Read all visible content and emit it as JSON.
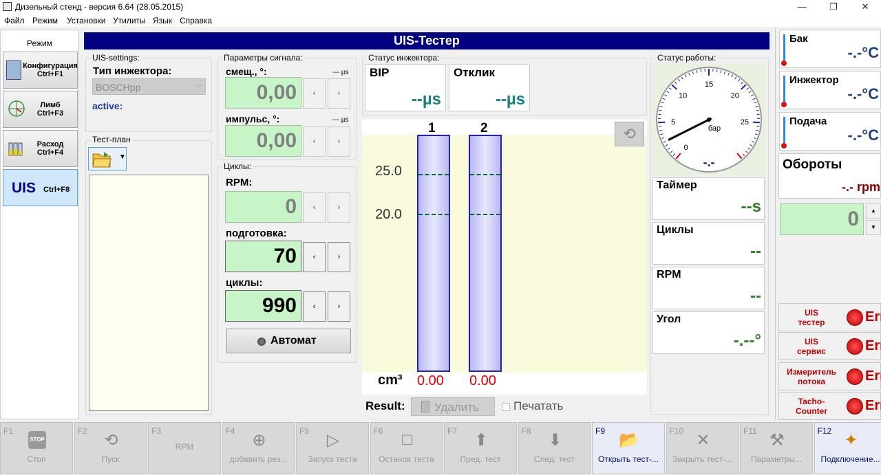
{
  "window": {
    "title": "Дизельный стенд - версия 6.64 (28.05.2015)",
    "min": "—",
    "max": "❐",
    "close": "✕"
  },
  "menu": [
    "Файл",
    "Режим",
    "Установки",
    "Утилиты",
    "Язык",
    "Справка"
  ],
  "mode": {
    "title": "Режим",
    "buttons": [
      {
        "label": "Конфигурация\nCtrl+F1"
      },
      {
        "label": "Лимб\nCtrl+F3"
      },
      {
        "label": "Расход\nCtrl+F4"
      },
      {
        "big": "UIS",
        "shortcut": "Ctrl+F8"
      }
    ]
  },
  "header": "UIS-Тестер",
  "settings": {
    "title": "UIS-settings:",
    "injector_type_label": "Тип инжектора:",
    "injector_type": "BOSCHpp",
    "status": "active:"
  },
  "testplan": {
    "title": "Тест-план"
  },
  "signal": {
    "title": "Параметры сигнала:",
    "offset_label": "смещ., °:",
    "offset_unit": "--- µs",
    "offset": "0,00",
    "pulse_label": "импульс, °:",
    "pulse_unit": "--- µs",
    "pulse": "0,00"
  },
  "cycles": {
    "title": "Циклы:",
    "rpm_label": "RPM:",
    "rpm": "0",
    "prep_label": "подготовка:",
    "prep": "70",
    "cycles_label": "циклы:",
    "cycles": "990",
    "auto": "Автомат"
  },
  "arrows": {
    "left": "‹",
    "right": "›"
  },
  "injector_status": {
    "title": "Статус инжектора:",
    "bip_label": "BIP",
    "bip": "--µs",
    "response_label": "Отклик",
    "response": "--µs"
  },
  "tubes": {
    "labels": [
      "1",
      "2"
    ],
    "ticks": [
      "25.0",
      "20.0"
    ],
    "unit": "cm³",
    "values": [
      "0.00",
      "0.00"
    ],
    "result_label": "Result:",
    "delete": "Удалить",
    "print": "Печатать"
  },
  "work_status": {
    "title": "Статус работы:",
    "gauge_ticks": [
      "0",
      "5",
      "10",
      "15",
      "20",
      "25"
    ],
    "gauge_unit": "бар",
    "gauge_value": "-.-",
    "needle_value_bar": 2.5,
    "gauge_max_bar": 30,
    "timer_label": "Таймер",
    "timer": "--s",
    "cycles_label": "Циклы",
    "cycles": "--",
    "rpm_label": "RPM",
    "rpm": "--",
    "angle_label": "Угол",
    "angle": "-.--°"
  },
  "right": {
    "tank_label": "Бак",
    "tank": "-.-°C",
    "injector_label": "Инжектор",
    "injector": "-.-°C",
    "feed_label": "Подача",
    "feed": "-.-°C",
    "rpm_label": "Обороты",
    "rpm": "-.- rpm",
    "rpm_set": "0"
  },
  "devices": [
    {
      "name": "UIS\nтестер",
      "state": "Err"
    },
    {
      "name": "UIS\nсервис",
      "state": "Err"
    },
    {
      "name": "Измеритель\nпотока",
      "state": "Err"
    },
    {
      "name": "Tacho-\nCounter",
      "state": "Err"
    }
  ],
  "fkeys": [
    {
      "key": "F1",
      "label": "Стоп"
    },
    {
      "key": "F2",
      "label": "Пуск"
    },
    {
      "key": "F3",
      "label": "RPM"
    },
    {
      "key": "F4",
      "label": "добавить рез..."
    },
    {
      "key": "F5",
      "label": "Запуск теста"
    },
    {
      "key": "F6",
      "label": "Останов теста"
    },
    {
      "key": "F7",
      "label": "Пред. тест"
    },
    {
      "key": "F8",
      "label": "След. тест"
    },
    {
      "key": "F9",
      "label": "Открыть тест-..."
    },
    {
      "key": "F10",
      "label": "Закрыть тест-..."
    },
    {
      "key": "F11",
      "label": "Параметры..."
    },
    {
      "key": "F12",
      "label": "Подключение..."
    }
  ]
}
